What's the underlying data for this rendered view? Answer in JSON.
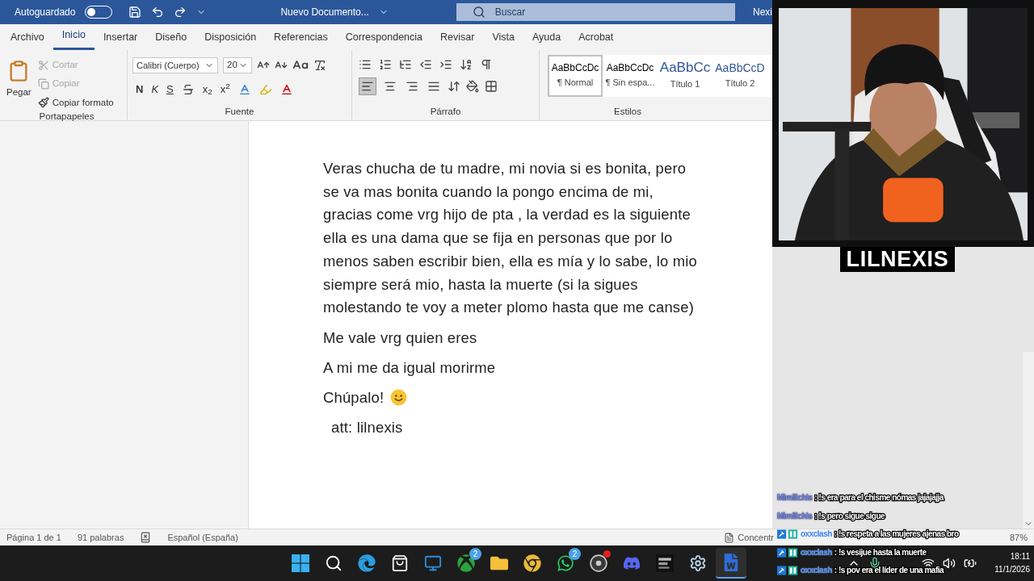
{
  "title_bar": {
    "autosave_label": "Autoguardado",
    "autosave_on": false,
    "document_title": "Nuevo Documento...",
    "search_placeholder": "Buscar",
    "user": "Nexi"
  },
  "tabs": [
    {
      "label": "Archivo",
      "selected": false
    },
    {
      "label": "Inicio",
      "selected": true
    },
    {
      "label": "Insertar",
      "selected": false
    },
    {
      "label": "Diseño",
      "selected": false
    },
    {
      "label": "Disposición",
      "selected": false
    },
    {
      "label": "Referencias",
      "selected": false
    },
    {
      "label": "Correspondencia",
      "selected": false
    },
    {
      "label": "Revisar",
      "selected": false
    },
    {
      "label": "Vista",
      "selected": false
    },
    {
      "label": "Ayuda",
      "selected": false
    },
    {
      "label": "Acrobat",
      "selected": false
    }
  ],
  "ribbon": {
    "clipboard": {
      "paste": "Pegar",
      "group": "Portapapeles",
      "actions": [
        {
          "kind": "cut",
          "label": "Cortar",
          "disabled": true
        },
        {
          "kind": "copy",
          "label": "Copiar",
          "disabled": true
        },
        {
          "kind": "painter",
          "label": "Copiar formato",
          "disabled": false
        }
      ]
    },
    "font": {
      "group": "Fuente",
      "name": "Calibri (Cuerpo)",
      "size": "20",
      "bold": "N",
      "italic": "K",
      "underline": "S",
      "subscript": "x$_{2}$",
      "superscript": "x$^{2}$"
    },
    "paragraph": {
      "group": "Párrafo",
      "alignments": [
        {
          "kind": "left",
          "selected": true
        },
        {
          "kind": "center",
          "selected": false
        },
        {
          "kind": "right",
          "selected": false
        },
        {
          "kind": "justify",
          "selected": false
        }
      ]
    },
    "styles": {
      "group": "Estilos",
      "items": [
        {
          "kind": "body",
          "preview": "AaBbCcDc",
          "name": "¶ Normal",
          "selected": true
        },
        {
          "kind": "body",
          "preview": "AaBbCcDc",
          "name": "¶ Sin espa...",
          "selected": false
        },
        {
          "kind": "heading1",
          "preview": "AaBbCc",
          "name": "Título 1",
          "selected": false
        },
        {
          "kind": "heading2",
          "preview": "AaBbCcD",
          "name": "Título 2",
          "selected": false
        }
      ]
    }
  },
  "document": {
    "paragraphs": [
      {
        "kind": "text",
        "indent": false,
        "text": "Veras chucha de tu madre, mi novia si es bonita, pero se va mas bonita cuando la pongo encima de mi, gracias come vrg hijo de pta , la verdad es la siguiente ella es una dama que se fija en personas que por lo menos saben escribir bien, ella es mía y lo sabe, lo mio siempre será mio, hasta la muerte (si la sigues molestando te voy a meter plomo hasta que me canse)"
      },
      {
        "kind": "text",
        "indent": false,
        "text": "Me vale vrg quien eres"
      },
      {
        "kind": "text",
        "indent": false,
        "text": "A mi me da igual morirme"
      },
      {
        "kind": "smiley",
        "indent": false,
        "text": "Chúpalo!"
      },
      {
        "kind": "text",
        "indent": true,
        "text": "att: lilnexis"
      }
    ]
  },
  "status_bar": {
    "page": "Página 1 de 1",
    "words": "91 palabras",
    "language": "Español (España)",
    "focus": "Concentr",
    "zoom": "87%"
  },
  "webcam": {
    "kind": "picture",
    "name": "LILNEXIS"
  },
  "chat": [
    {
      "user": "Mimilichis",
      "badged": false,
      "color": "#7d8fe0",
      "text": ": !s era para el chisme nómas jajajajja"
    },
    {
      "user": "Mimilichis",
      "badged": false,
      "color": "#7d8fe0",
      "text": ": !s pero sigue sigue"
    },
    {
      "user": "oxxclash",
      "badged": true,
      "color": "#3b82f6",
      "text": ": !s respeta a las mujeres ajenas bro"
    },
    {
      "user": "oxxclash",
      "badged": true,
      "color": "#3b82f6",
      "text": ": !s vesijue hasta la muerte"
    },
    {
      "user": "oxxclash",
      "badged": true,
      "color": "#3b82f6",
      "text": ": !s pov era el líder de una mafia"
    }
  ],
  "taskbar": {
    "apps": [
      {
        "kind": "start",
        "selected": false
      },
      {
        "kind": "search",
        "selected": false
      },
      {
        "kind": "edge",
        "selected": false
      },
      {
        "kind": "store",
        "selected": false
      },
      {
        "kind": "monitor",
        "selected": false
      },
      {
        "kind": "xbox",
        "badge": "2",
        "selected": false
      },
      {
        "kind": "folder",
        "selected": false
      },
      {
        "kind": "chrome",
        "selected": false
      },
      {
        "kind": "whatsapp",
        "badge": "2",
        "selected": false
      },
      {
        "kind": "obs",
        "dot": true,
        "selected": false
      },
      {
        "kind": "discord",
        "selected": false
      },
      {
        "kind": "game",
        "selected": false
      },
      {
        "kind": "settings",
        "selected": false
      },
      {
        "kind": "word",
        "selected": true
      }
    ],
    "time": "18:11",
    "date": "11/1/2026"
  }
}
